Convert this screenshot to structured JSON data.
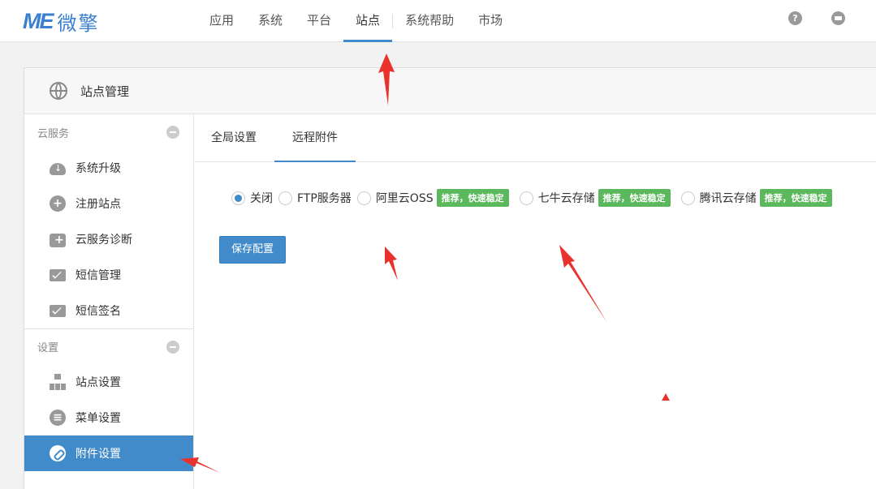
{
  "header": {
    "logo_mark": "ME",
    "logo_text": "微擎",
    "nav": [
      {
        "label": "应用"
      },
      {
        "label": "系统"
      },
      {
        "label": "平台"
      },
      {
        "label": "站点",
        "active": true
      },
      {
        "label": "系统帮助"
      },
      {
        "label": "市场"
      }
    ],
    "icons": [
      "help-icon",
      "message-icon"
    ],
    "help_glyph": "?"
  },
  "panel": {
    "title": "站点管理",
    "icon": "globe-icon"
  },
  "sidebar": {
    "groups": [
      {
        "title": "云服务",
        "items": [
          {
            "label": "系统升级",
            "icon": "cloud-download-icon"
          },
          {
            "label": "注册站点",
            "icon": "plus-circle-icon"
          },
          {
            "label": "云服务诊断",
            "icon": "medical-kit-icon"
          },
          {
            "label": "短信管理",
            "icon": "mail-settings-icon"
          },
          {
            "label": "短信签名",
            "icon": "mail-user-icon"
          }
        ]
      },
      {
        "title": "设置",
        "items": [
          {
            "label": "站点设置",
            "icon": "sitemap-icon"
          },
          {
            "label": "菜单设置",
            "icon": "list-icon"
          },
          {
            "label": "附件设置",
            "icon": "link-icon",
            "active": true
          }
        ]
      }
    ]
  },
  "tabs": [
    {
      "label": "全局设置"
    },
    {
      "label": "远程附件",
      "active": true
    }
  ],
  "storage_options": [
    {
      "label": "关闭",
      "checked": true
    },
    {
      "label": "FTP服务器",
      "checked": false
    },
    {
      "label": "阿里云OSS",
      "checked": false,
      "badge": "推荐，快速稳定"
    },
    {
      "label": "七牛云存储",
      "checked": false,
      "badge": "推荐，快速稳定"
    },
    {
      "label": "腾讯云存储",
      "checked": false,
      "badge": "推荐，快速稳定"
    }
  ],
  "save_button": "保存配置",
  "colors": {
    "accent": "#428bca",
    "badge": "#5cb85c",
    "annotation": "#e8322b"
  }
}
